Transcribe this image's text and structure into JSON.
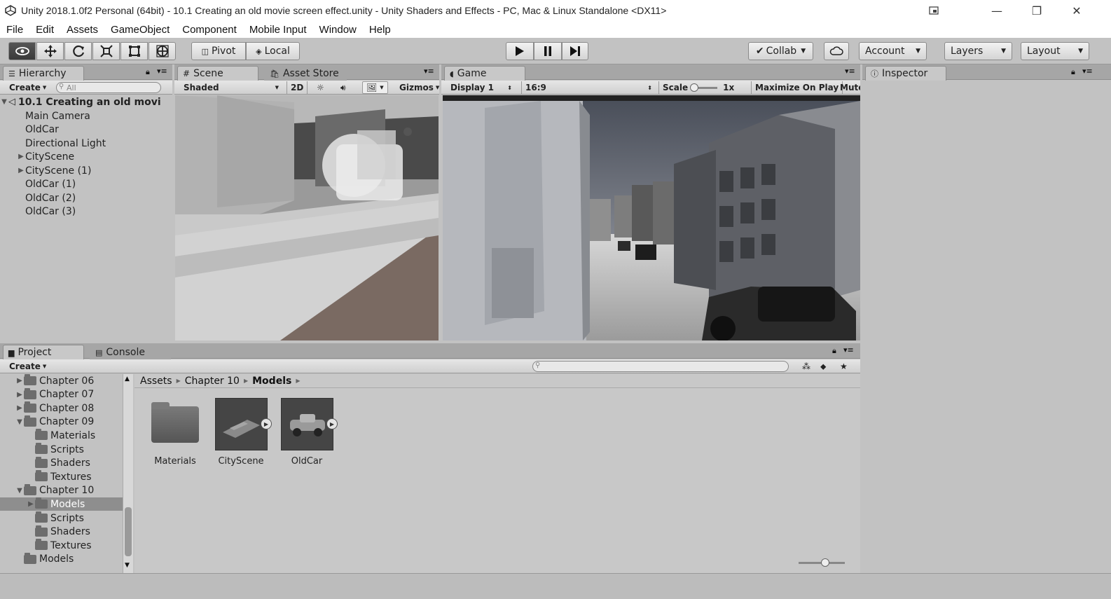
{
  "window": {
    "title": "Unity 2018.1.0f2 Personal (64bit) - 10.1 Creating an old movie screen effect.unity - Unity Shaders and Effects - PC, Mac & Linux Standalone <DX11>",
    "buttons": {
      "minimize": "—",
      "maximize": "❐",
      "close": "✕"
    }
  },
  "menu": [
    "File",
    "Edit",
    "Assets",
    "GameObject",
    "Component",
    "Mobile Input",
    "Window",
    "Help"
  ],
  "toolbar": {
    "tools": [
      "hand-eye-icon",
      "move-icon",
      "rotate-icon",
      "scale-icon",
      "rect-icon",
      "transform-icon"
    ],
    "pivot": "Pivot",
    "local": "Local",
    "collab": "Collab",
    "account": "Account",
    "layers": "Layers",
    "layout": "Layout"
  },
  "hierarchy": {
    "tab": "Hierarchy",
    "create": "Create",
    "search_placeholder": "All",
    "scene_name": "10.1 Creating an old movi",
    "items": [
      {
        "label": "Main Camera",
        "foldable": false
      },
      {
        "label": "OldCar",
        "foldable": false
      },
      {
        "label": "Directional Light",
        "foldable": false
      },
      {
        "label": "CityScene",
        "foldable": true
      },
      {
        "label": "CityScene (1)",
        "foldable": true
      },
      {
        "label": "OldCar (1)",
        "foldable": false
      },
      {
        "label": "OldCar (2)",
        "foldable": false
      },
      {
        "label": "OldCar (3)",
        "foldable": false
      }
    ]
  },
  "scene": {
    "tab": "Scene",
    "asset_store_tab": "Asset Store",
    "shading": "Shaded",
    "mode_2d": "2D",
    "gizmos": "Gizmos"
  },
  "game": {
    "tab": "Game",
    "display": "Display 1",
    "aspect": "16:9",
    "scale_label": "Scale",
    "scale_value": "1x",
    "maximize": "Maximize On Play",
    "mute": "Mute"
  },
  "inspector": {
    "tab": "Inspector"
  },
  "project": {
    "tab": "Project",
    "console_tab": "Console",
    "create": "Create",
    "breadcrumb": [
      "Assets",
      "Chapter 10",
      "Models"
    ],
    "tree": [
      {
        "label": "Chapter 06",
        "indent": 1,
        "fold": "closed"
      },
      {
        "label": "Chapter 07",
        "indent": 1,
        "fold": "closed"
      },
      {
        "label": "Chapter 08",
        "indent": 1,
        "fold": "closed"
      },
      {
        "label": "Chapter 09",
        "indent": 1,
        "fold": "open"
      },
      {
        "label": "Materials",
        "indent": 2,
        "fold": "none"
      },
      {
        "label": "Scripts",
        "indent": 2,
        "fold": "none"
      },
      {
        "label": "Shaders",
        "indent": 2,
        "fold": "none"
      },
      {
        "label": "Textures",
        "indent": 2,
        "fold": "none"
      },
      {
        "label": "Chapter 10",
        "indent": 1,
        "fold": "open"
      },
      {
        "label": "Models",
        "indent": 2,
        "fold": "closed",
        "selected": true
      },
      {
        "label": "Scripts",
        "indent": 2,
        "fold": "none"
      },
      {
        "label": "Shaders",
        "indent": 2,
        "fold": "none"
      },
      {
        "label": "Textures",
        "indent": 2,
        "fold": "none"
      },
      {
        "label": "Models",
        "indent": 1,
        "fold": "none"
      }
    ],
    "assets": [
      {
        "label": "Materials",
        "kind": "folder"
      },
      {
        "label": "CityScene",
        "kind": "model"
      },
      {
        "label": "OldCar",
        "kind": "model"
      }
    ]
  }
}
